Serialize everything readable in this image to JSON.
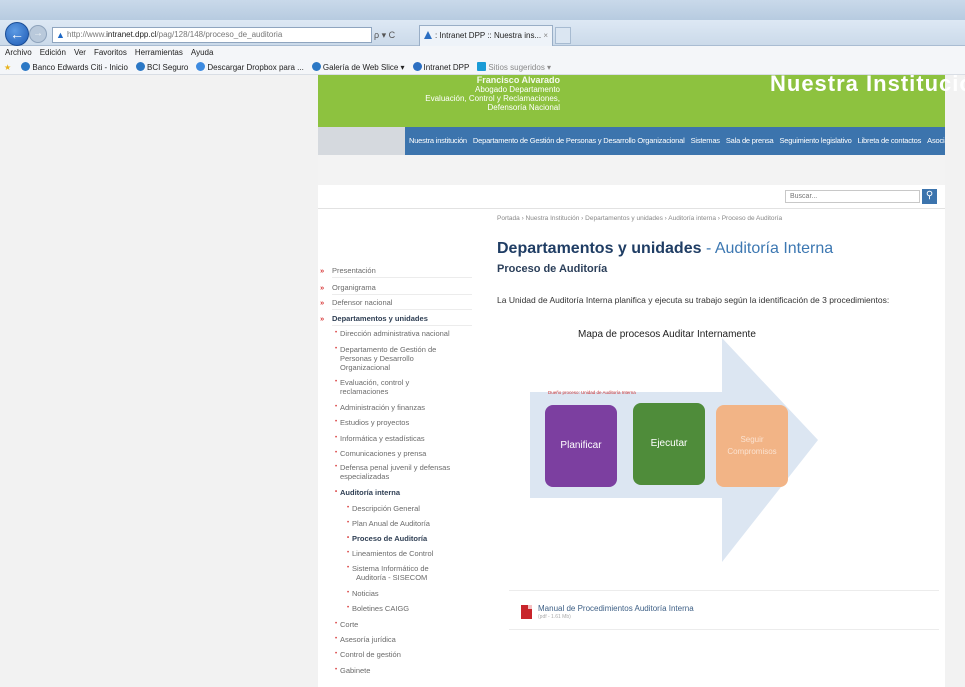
{
  "browser": {
    "url_prefix": "http://www.",
    "url_domain": "intranet.dpp.cl",
    "url_path": "/pag/128/148/proceso_de_auditoria",
    "addr_controls": "ρ ▾ C",
    "tab_title": ": Intranet DPP :: Nuestra ins...",
    "tab_close": "×",
    "back_glyph": "←",
    "forward_glyph": "→",
    "menu": [
      "Archivo",
      "Edición",
      "Ver",
      "Favoritos",
      "Herramientas",
      "Ayuda"
    ],
    "favorites": [
      {
        "label": "Banco Edwards Citi - Inicio",
        "icon": "ie-page-icon",
        "color": "#2b78c5"
      },
      {
        "label": "BCI Seguro",
        "icon": "ie-page-icon",
        "color": "#2b78c5"
      },
      {
        "label": "Descargar Dropbox para ...",
        "icon": "dropbox-icon",
        "color": "#3d8be0"
      },
      {
        "label": "Galería de Web Slice ▾",
        "icon": "ie-page-icon",
        "color": "#2b78c5"
      },
      {
        "label": "Intranet DPP",
        "icon": "dpp-logo-icon",
        "color": "#2c6fc2"
      },
      {
        "label": "Sitios sugeridos ▾",
        "icon": "bing-icon",
        "color": "#1a9bd6"
      }
    ],
    "favorites_star_color": "#e8b21c"
  },
  "banner": {
    "name": "Francisco Alvarado",
    "line1": "Abogado Departamento",
    "line2": "Evaluación, Control y Reclamaciones,",
    "line3": "Defensoría Nacional",
    "site_title": "Nuestra Institución",
    "green": "#8dc23f"
  },
  "topnav": [
    "Nuestra institución",
    "Departamento de Gestión de Personas y Desarrollo Organizacional",
    "Sistemas",
    "Sala de prensa",
    "Seguimiento legislativo",
    "Libreta de contactos",
    "Asociaciones"
  ],
  "search": {
    "placeholder": "Buscar...",
    "icon": "search-icon"
  },
  "breadcrumb": "Portada  › Nuestra Institución  › Departamentos y unidades  › Auditoría interna  › Proceso de Auditoría",
  "content": {
    "heading_main": "Departamentos y unidades",
    "heading_sep": " - ",
    "heading_sub": "Auditoría Interna",
    "subheading": "Proceso de Auditoría",
    "intro": "La Unidad de Auditoría Interna planifica y ejecuta su trabajo según la identificación de 3 procedimientos:"
  },
  "diagram": {
    "title": "Mapa de procesos Auditar Internamente",
    "owner_label": "Dueño proceso: Unidad de Auditoría Interna",
    "steps": [
      {
        "label": "Planificar",
        "color": "#7c3fa0"
      },
      {
        "label": "Ejecutar",
        "color": "#4f8c3a"
      },
      {
        "label": "Seguir Compromisos",
        "color": "#f2b486"
      }
    ],
    "arrow_color": "#dce6f2"
  },
  "document": {
    "title": "Manual de Procedimientos Auditoría Interna",
    "meta": "(pdf - 1.61 Mb)"
  },
  "sidebar": {
    "main_items": [
      {
        "label": "Presentación"
      },
      {
        "label": "Organigrama"
      },
      {
        "label": "Defensor nacional"
      },
      {
        "label": "Departamentos y unidades"
      }
    ],
    "sub_items": [
      "Dirección administrativa nacional",
      "Departamento de Gestión de",
      "Personas y Desarrollo",
      "Organizacional",
      "Evaluación, control y",
      "reclamaciones",
      "Administración y finanzas",
      "Estudios y proyectos",
      "Informática y estadísticas",
      "Comunicaciones y prensa",
      "Defensa penal juvenil y defensas",
      "especializadas",
      "Auditoría interna"
    ],
    "subsub_items": [
      "Descripción General",
      "Plan Anual de Auditoría",
      "Proceso de Auditoría",
      "Lineamientos de Control",
      "Sistema Informático de",
      "Auditoría - SISECOM",
      "Noticias",
      "Boletines CAIGG"
    ],
    "tail_items": [
      "Corte",
      "Asesoría jurídica",
      "Control de gestión",
      "Gabinete"
    ]
  }
}
